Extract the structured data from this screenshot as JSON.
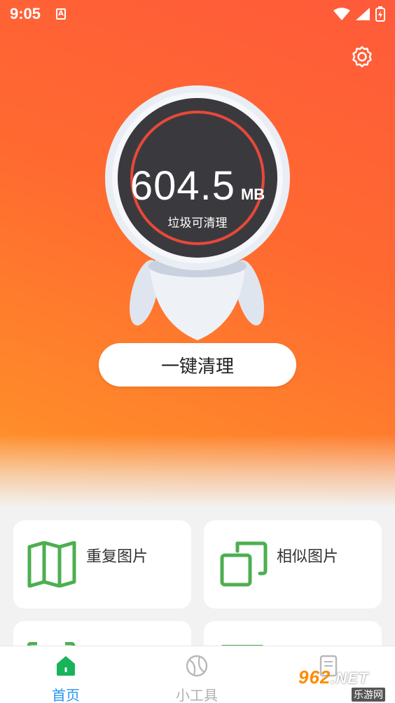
{
  "status_bar": {
    "time": "9:05",
    "app_icon": "A"
  },
  "junk": {
    "value": "604.5",
    "unit": "MB",
    "label": "垃圾可清理"
  },
  "clean_button": {
    "label": "一键清理"
  },
  "cards": [
    {
      "label": "重复图片",
      "icon": "map-icon"
    },
    {
      "label": "相似图片",
      "icon": "copy-icon"
    }
  ],
  "nav": [
    {
      "label": "首页",
      "icon": "home-icon",
      "active": true
    },
    {
      "label": "小工具",
      "icon": "ball-icon",
      "active": false
    }
  ],
  "watermark": {
    "brand": "962",
    "suffix": ".NET",
    "sub": "乐游网"
  },
  "colors": {
    "accent_green": "#4caf50",
    "nav_active": "#2196f3",
    "hero_orange": "#ff6a30",
    "ring_red": "#e8483a"
  }
}
